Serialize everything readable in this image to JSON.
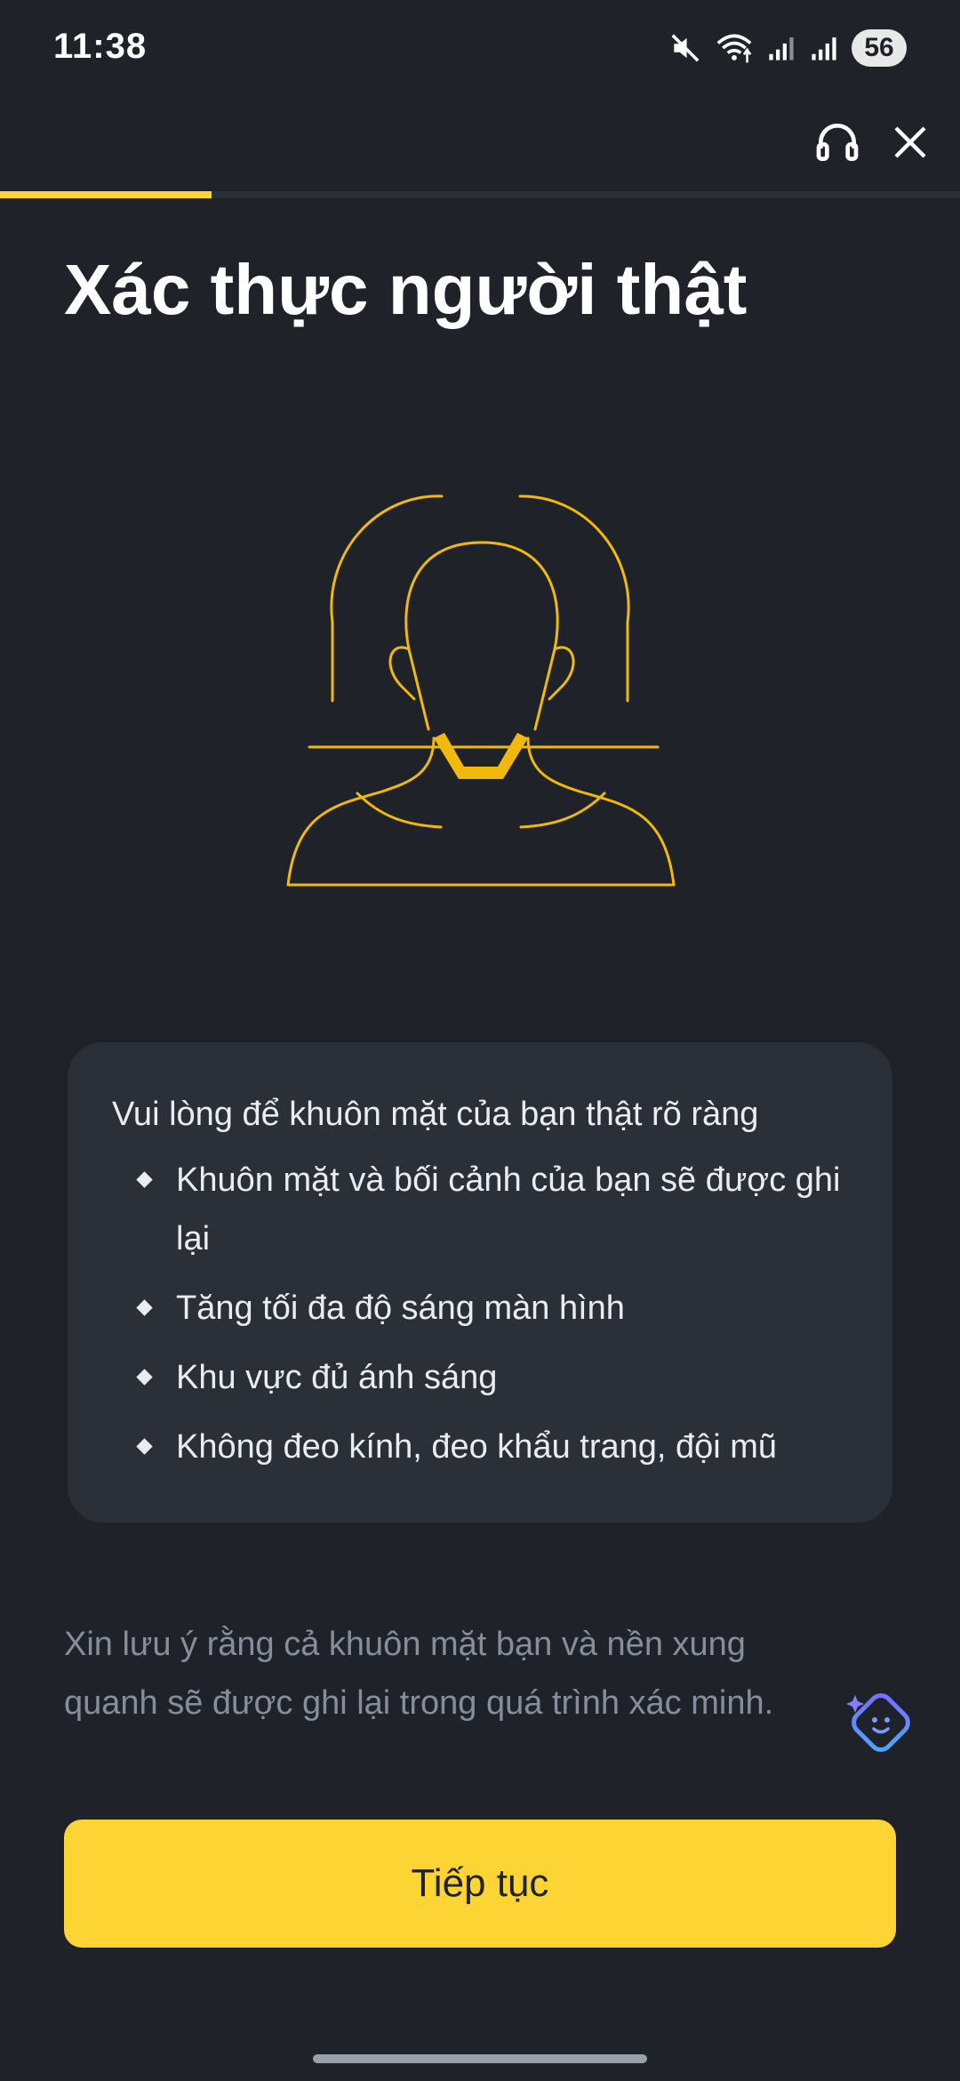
{
  "status_bar": {
    "time": "11:38",
    "battery": "56",
    "icons": [
      "mute-icon",
      "wifi-icon",
      "signal-icon",
      "signal-icon"
    ]
  },
  "top_nav": {
    "icons": [
      "headset-icon",
      "close-icon"
    ]
  },
  "progress": {
    "value": 0.22,
    "color": "#fcd535"
  },
  "title": "Xác thực người thật",
  "illustration": {
    "icon": "face-scan-illustration",
    "color": "#f0b90b"
  },
  "instructions": {
    "heading": "Vui lòng để khuôn mặt của bạn thật rõ ràng",
    "items": [
      "Khuôn mặt và bối cảnh của bạn sẽ được ghi lại",
      "Tăng tối đa độ sáng màn hình",
      "Khu vực đủ ánh sáng",
      "Không đeo kính, đeo khẩu trang, đội mũ"
    ]
  },
  "note": "Xin lưu ý rằng cả khuôn mặt bạn và nền xung quanh sẽ được ghi lại trong quá trình xác minh.",
  "assistant": {
    "icon": "ai-assistant-icon"
  },
  "continue_button": {
    "label": "Tiếp tục",
    "color": "#fcd535"
  },
  "colors": {
    "background": "#1f2329",
    "card": "#2a2f38",
    "accent": "#fcd535"
  }
}
